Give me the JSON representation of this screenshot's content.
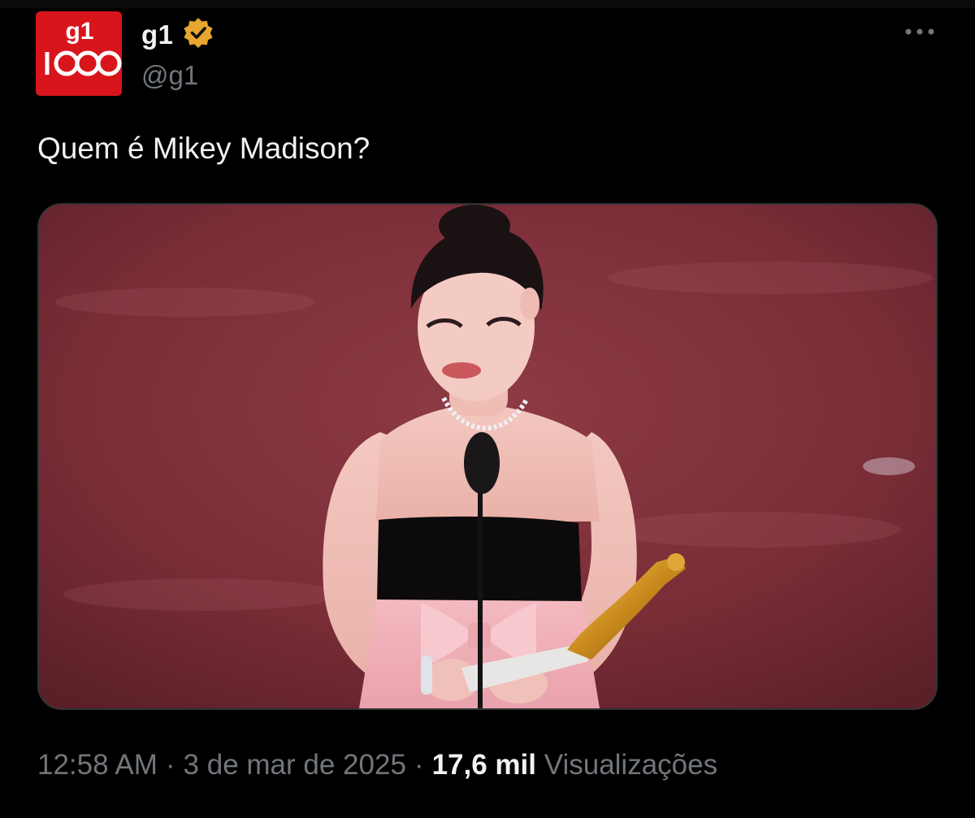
{
  "post": {
    "author": {
      "display_name": "g1",
      "handle": "@g1",
      "verified": true,
      "verified_badge_color": "#e8a530",
      "avatar": {
        "top_text": "g1",
        "bottom_text": "100",
        "background": "#d9151c"
      }
    },
    "text": "Quem é Mikey Madison?",
    "media": {
      "type": "photo",
      "alt_icon": "photo-award-speech"
    },
    "meta": {
      "time": "12:58 AM",
      "separator": "·",
      "date": "3 de mar de 2025",
      "views_count": "17,6 mil",
      "views_label": "Visualizações"
    },
    "more_icon": "more-horizontal-icon"
  }
}
